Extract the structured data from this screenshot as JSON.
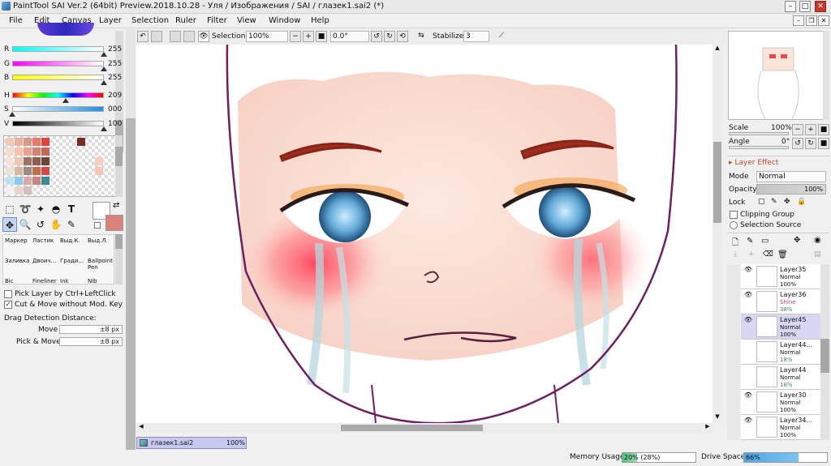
{
  "window": {
    "title": "PaintTool SAI Ver.2 (64bit) Preview.2018.10.28 - Уля / Изображения / SAI / глазек1.sai2 (*)",
    "controls": [
      "–",
      "□",
      "✕"
    ]
  },
  "menu": {
    "items": [
      "File",
      "Edit",
      "Canvas",
      "Layer",
      "Selection",
      "Ruler",
      "Filter",
      "View",
      "Window",
      "Help"
    ],
    "mdi_controls": [
      "–",
      "❐",
      "✕"
    ]
  },
  "toolbar": {
    "selection_label": "Selection",
    "zoom": "100%",
    "angle": "0.0°",
    "stabilizer_label": "Stabilizer",
    "stabilizer_value": "3"
  },
  "color": {
    "r_label": "R",
    "r_value": "255",
    "g_label": "G",
    "g_value": "255",
    "b_label": "B",
    "b_value": "255",
    "h_label": "H",
    "h_value": "209",
    "s_label": "S",
    "s_value": "000",
    "v_label": "V",
    "v_value": "100",
    "r_level": 1.0,
    "g_level": 1.0,
    "b_level": 1.0,
    "h_level": 0.58,
    "s_level": 0.0,
    "v_level": 1.0,
    "primary_color": "#ffffff",
    "secondary_color": "#d9837c"
  },
  "swatches": [
    "#f2c9b8",
    "#e8b39c",
    "#d99a85",
    "#e57a6c",
    "#e0433b",
    "#ffffff",
    "#ffffff",
    "#ffffff",
    "#7a2a24",
    "#ffffff",
    "#ffffff",
    "#ffffff",
    "#f5dcd0",
    "#f0c4b0",
    "#e9a28e",
    "#d2836f",
    "#c2695a",
    "#ffffff",
    "#ffffff",
    "#ffffff",
    "#ffffff",
    "#ffffff",
    "#ffffff",
    "#ffffff",
    "#f7e3d8",
    "#eec6b4",
    "#a07463",
    "#8d5d4f",
    "#6b4539",
    "#ffffff",
    "#ffffff",
    "#ffffff",
    "#ffffff",
    "#ffffff",
    "#f6d0bf",
    "#ffffff",
    "#eee1d6",
    "#dcb6a5",
    "#9f8a82",
    "#c46a4f",
    "#d44a44",
    "#ffffff",
    "#ffffff",
    "#ffffff",
    "#ffffff",
    "#ffffff",
    "#f3c6b6",
    "#ffffff",
    "#bde4f5",
    "#8fc9e9",
    "#d7a9a8",
    "#c88480",
    "#3d8a8f",
    "#ffffff",
    "#ffffff",
    "#ffffff",
    "#ffffff",
    "#ffffff",
    "#ffffff",
    "#ffffff",
    "#f0f0f0",
    "#e6d5cd",
    "#d3c0ba",
    "#ffffff",
    "#ffffff",
    "#ffffff",
    "#ffffff",
    "#ffffff",
    "#ffffff",
    "#ffffff",
    "#ffffff",
    "#ffffff"
  ],
  "tools": {
    "pens": [
      [
        "Маркер",
        "Ластик",
        "Выд.К.",
        "Выд.Л."
      ],
      [
        "Заливка",
        "Двоич...",
        "Гради...",
        "Ballpoint Pen"
      ],
      [
        "Bic",
        "Fineliner",
        "Ink",
        "Nib"
      ]
    ],
    "icons": [
      "select-rect-icon",
      "lasso-icon",
      "magic-wand-icon",
      "fill-select-icon",
      "text-icon",
      "move-icon",
      "zoom-icon",
      "rotate-icon",
      "hand-icon",
      "eyedropper-icon"
    ]
  },
  "options": {
    "pick_layer": "Pick Layer by Ctrl+LeftClick",
    "pick_layer_checked": false,
    "cut_move": "Cut & Move without Mod. Key",
    "cut_move_checked": true,
    "drag_title": "Drag Detection Distance:",
    "move_label": "Move",
    "move_value": "±8 px",
    "pick_move_label": "Pick & Move",
    "pick_move_value": "±8 px"
  },
  "navigator": {
    "scale_label": "Scale",
    "scale_value": "100%",
    "angle_label": "Angle",
    "angle_value": "0°"
  },
  "layer_props": {
    "effect_label": "Layer Effect",
    "mode_label": "Mode",
    "mode_value": "Normal",
    "opacity_label": "Opacity",
    "opacity_value": "100%",
    "lock_label": "Lock",
    "clipping_group": "Clipping Group",
    "selection_source": "Selection Source"
  },
  "layers": [
    {
      "name": "Layer35",
      "mode": "Normal",
      "opacity": "100%",
      "visible": true,
      "selected": false
    },
    {
      "name": "Layer36",
      "mode": "Shine",
      "opacity": "38%",
      "visible": true,
      "selected": false
    },
    {
      "name": "Layer45",
      "mode": "Normal",
      "opacity": "100%",
      "visible": true,
      "selected": true
    },
    {
      "name": "Layer44...",
      "mode": "Normal",
      "opacity": "18%",
      "visible": false,
      "selected": false
    },
    {
      "name": "Layer44",
      "mode": "Normal",
      "opacity": "18%",
      "visible": false,
      "selected": false
    },
    {
      "name": "Layer30",
      "mode": "Normal",
      "opacity": "100%",
      "visible": true,
      "selected": false
    },
    {
      "name": "Layer34...",
      "mode": "Normal",
      "opacity": "100%",
      "visible": true,
      "selected": false
    }
  ],
  "document_tab": {
    "name": "глазек1.sai2",
    "zoom": "100%"
  },
  "status": {
    "memory_label": "Memory Usage",
    "memory_value": "20% (28%)",
    "memory_level": 0.2,
    "drive_label": "Drive Space",
    "drive_value": "66%",
    "drive_level": 0.66
  }
}
